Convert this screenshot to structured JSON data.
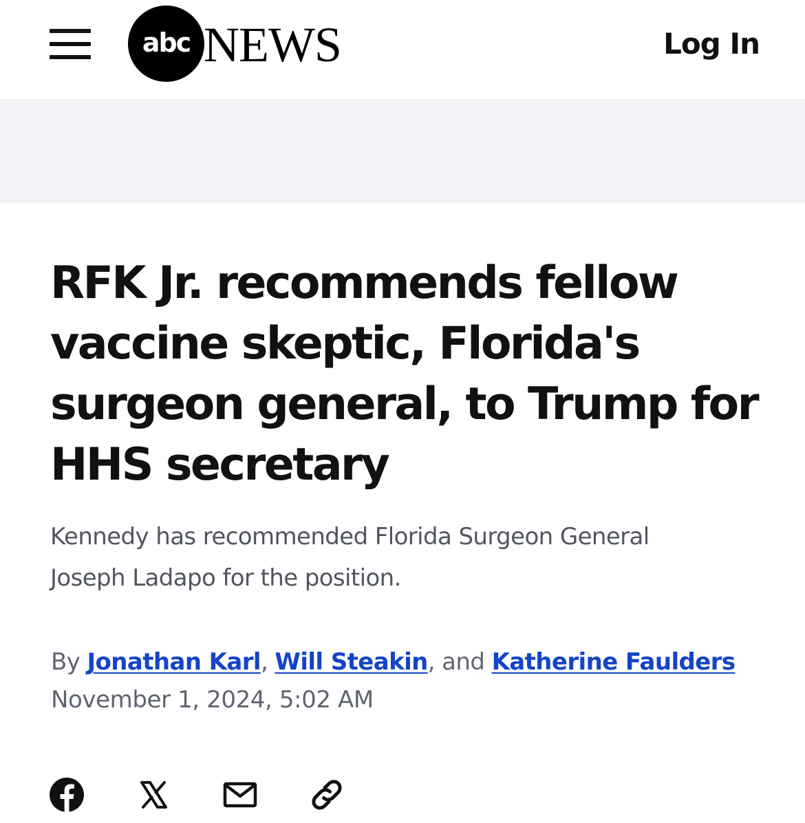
{
  "header": {
    "menu_icon": "hamburger-menu-icon",
    "logo": {
      "circle_text": "abc",
      "wordmark": "NEWS"
    },
    "login_label": "Log In"
  },
  "article": {
    "headline": "RFK Jr. recommends fellow vaccine skeptic, Florida's surgeon general, to Trump for HHS secretary",
    "subheadline": "Kennedy has recommended Florida Surgeon General Joseph Ladapo for the position.",
    "byline": {
      "prefix": "By",
      "authors": [
        "Jonathan Karl",
        "Will Steakin",
        "Katherine Faulders"
      ],
      "separator_1": ",",
      "separator_2": ", and"
    },
    "timestamp": "November 1, 2024, 5:02 AM"
  },
  "share": {
    "icons": [
      "facebook-icon",
      "x-icon",
      "email-icon",
      "link-icon"
    ]
  },
  "colors": {
    "text_primary": "#111111",
    "text_secondary": "#505560",
    "link": "#1444c8",
    "ad_band": "#f1f2f5",
    "logo": "#000000"
  }
}
